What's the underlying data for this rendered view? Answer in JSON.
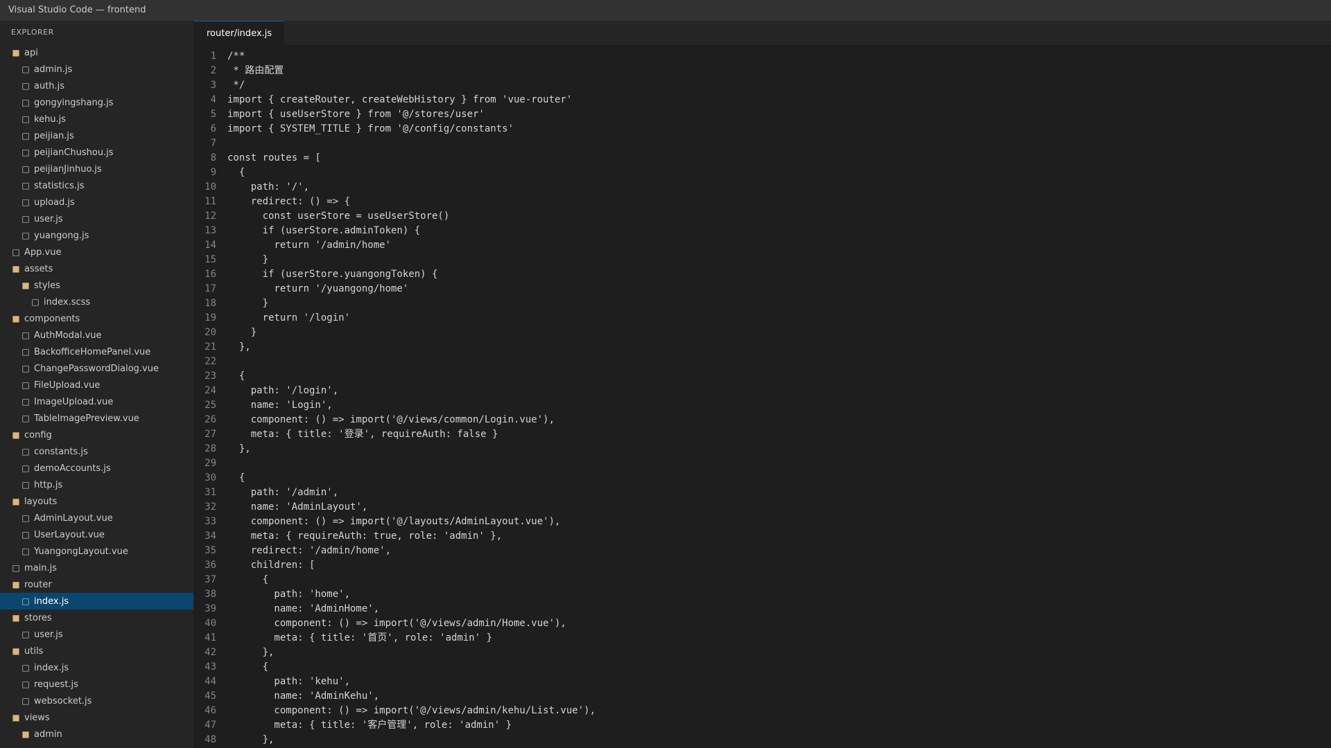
{
  "window": {
    "title": "Visual Studio Code — frontend"
  },
  "sidebar": {
    "header": "EXPLORER",
    "items": [
      {
        "label": "api",
        "type": "folder",
        "depth": 0
      },
      {
        "label": "admin.js",
        "type": "file",
        "depth": 1
      },
      {
        "label": "auth.js",
        "type": "file",
        "depth": 1
      },
      {
        "label": "gongyingshang.js",
        "type": "file",
        "depth": 1
      },
      {
        "label": "kehu.js",
        "type": "file",
        "depth": 1
      },
      {
        "label": "peijian.js",
        "type": "file",
        "depth": 1
      },
      {
        "label": "peijianChushou.js",
        "type": "file",
        "depth": 1
      },
      {
        "label": "peijianJinhuo.js",
        "type": "file",
        "depth": 1
      },
      {
        "label": "statistics.js",
        "type": "file",
        "depth": 1
      },
      {
        "label": "upload.js",
        "type": "file",
        "depth": 1
      },
      {
        "label": "user.js",
        "type": "file",
        "depth": 1
      },
      {
        "label": "yuangong.js",
        "type": "file",
        "depth": 1
      },
      {
        "label": "App.vue",
        "type": "file",
        "depth": 0
      },
      {
        "label": "assets",
        "type": "folder",
        "depth": 0
      },
      {
        "label": "styles",
        "type": "folder",
        "depth": 1
      },
      {
        "label": "index.scss",
        "type": "file",
        "depth": 2
      },
      {
        "label": "components",
        "type": "folder",
        "depth": 0
      },
      {
        "label": "AuthModal.vue",
        "type": "file",
        "depth": 1
      },
      {
        "label": "BackofficeHomePanel.vue",
        "type": "file",
        "depth": 1
      },
      {
        "label": "ChangePasswordDialog.vue",
        "type": "file",
        "depth": 1
      },
      {
        "label": "FileUpload.vue",
        "type": "file",
        "depth": 1
      },
      {
        "label": "ImageUpload.vue",
        "type": "file",
        "depth": 1
      },
      {
        "label": "TableImagePreview.vue",
        "type": "file",
        "depth": 1
      },
      {
        "label": "config",
        "type": "folder",
        "depth": 0
      },
      {
        "label": "constants.js",
        "type": "file",
        "depth": 1
      },
      {
        "label": "demoAccounts.js",
        "type": "file",
        "depth": 1
      },
      {
        "label": "http.js",
        "type": "file",
        "depth": 1
      },
      {
        "label": "layouts",
        "type": "folder",
        "depth": 0
      },
      {
        "label": "AdminLayout.vue",
        "type": "file",
        "depth": 1
      },
      {
        "label": "UserLayout.vue",
        "type": "file",
        "depth": 1
      },
      {
        "label": "YuangongLayout.vue",
        "type": "file",
        "depth": 1
      },
      {
        "label": "main.js",
        "type": "file",
        "depth": 0
      },
      {
        "label": "router",
        "type": "folder",
        "depth": 0
      },
      {
        "label": "index.js",
        "type": "file",
        "depth": 1,
        "selected": true
      },
      {
        "label": "stores",
        "type": "folder",
        "depth": 0
      },
      {
        "label": "user.js",
        "type": "file",
        "depth": 1
      },
      {
        "label": "utils",
        "type": "folder",
        "depth": 0
      },
      {
        "label": "index.js",
        "type": "file",
        "depth": 1
      },
      {
        "label": "request.js",
        "type": "file",
        "depth": 1
      },
      {
        "label": "websocket.js",
        "type": "file",
        "depth": 1
      },
      {
        "label": "views",
        "type": "folder",
        "depth": 0
      },
      {
        "label": "admin",
        "type": "folder",
        "depth": 1
      }
    ]
  },
  "editor": {
    "tabs": [
      {
        "label": "router/index.js",
        "active": true
      }
    ],
    "lines": [
      "/**",
      " * 路由配置",
      " */",
      "import { createRouter, createWebHistory } from 'vue-router'",
      "import { useUserStore } from '@/stores/user'",
      "import { SYSTEM_TITLE } from '@/config/constants'",
      "",
      "const routes = [",
      "  {",
      "    path: '/',",
      "    redirect: () => {",
      "      const userStore = useUserStore()",
      "      if (userStore.adminToken) {",
      "        return '/admin/home'",
      "      }",
      "      if (userStore.yuangongToken) {",
      "        return '/yuangong/home'",
      "      }",
      "      return '/login'",
      "    }",
      "  },",
      "",
      "  {",
      "    path: '/login',",
      "    name: 'Login',",
      "    component: () => import('@/views/common/Login.vue'),",
      "    meta: { title: '登录', requireAuth: false }",
      "  },",
      "",
      "  {",
      "    path: '/admin',",
      "    name: 'AdminLayout',",
      "    component: () => import('@/layouts/AdminLayout.vue'),",
      "    meta: { requireAuth: true, role: 'admin' },",
      "    redirect: '/admin/home',",
      "    children: [",
      "      {",
      "        path: 'home',",
      "        name: 'AdminHome',",
      "        component: () => import('@/views/admin/Home.vue'),",
      "        meta: { title: '首页', role: 'admin' }",
      "      },",
      "      {",
      "        path: 'kehu',",
      "        name: 'AdminKehu',",
      "        component: () => import('@/views/admin/kehu/List.vue'),",
      "        meta: { title: '客户管理', role: 'admin' }",
      "      },"
    ]
  },
  "colors": {
    "accent": "#0e639c",
    "selection": "#094771",
    "folder": "#dcb67a"
  }
}
